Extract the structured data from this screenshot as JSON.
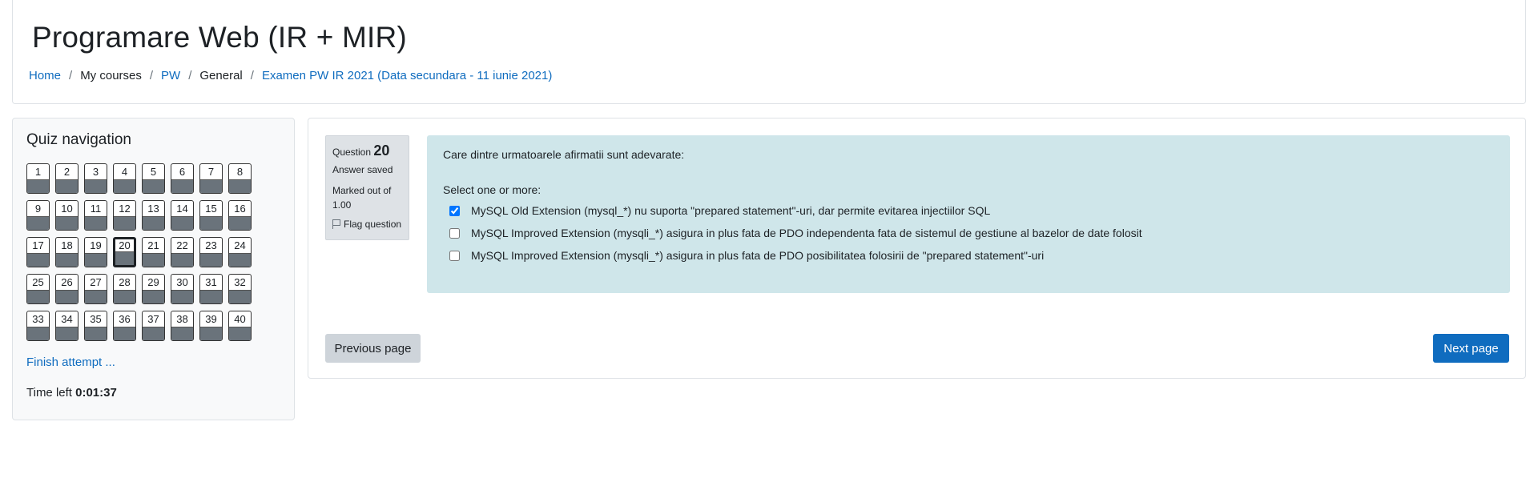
{
  "header": {
    "course_title": "Programare Web (IR + MIR)",
    "breadcrumb": [
      {
        "label": "Home",
        "link": true
      },
      {
        "label": "My courses",
        "link": false
      },
      {
        "label": "PW",
        "link": true
      },
      {
        "label": "General",
        "link": false
      },
      {
        "label": "Examen PW IR 2021 (Data secundara - 11 iunie 2021)",
        "link": true
      }
    ],
    "separator": "/"
  },
  "quiz_nav": {
    "title": "Quiz navigation",
    "questions": [
      "1",
      "2",
      "3",
      "4",
      "5",
      "6",
      "7",
      "8",
      "9",
      "10",
      "11",
      "12",
      "13",
      "14",
      "15",
      "16",
      "17",
      "18",
      "19",
      "20",
      "21",
      "22",
      "23",
      "24",
      "25",
      "26",
      "27",
      "28",
      "29",
      "30",
      "31",
      "32",
      "33",
      "34",
      "35",
      "36",
      "37",
      "38",
      "39",
      "40"
    ],
    "current": "20",
    "finish_label": "Finish attempt ...",
    "time_left_label": "Time left",
    "time_left_value": "0:01:37"
  },
  "question": {
    "label": "Question",
    "number": "20",
    "state": "Answer saved",
    "grade": "Marked out of 1.00",
    "flag_label": "Flag question",
    "text": "Care dintre urmatoarele afirmatii sunt adevarate:",
    "prompt": "Select one or more:",
    "answers": [
      {
        "label": "MySQL Old Extension (mysql_*) nu suporta \"prepared statement\"-uri, dar permite evitarea injectiilor SQL",
        "checked": true
      },
      {
        "label": "MySQL Improved Extension (mysqli_*) asigura in plus fata de PDO independenta fata de sistemul de gestiune al bazelor de date folosit",
        "checked": false
      },
      {
        "label": "MySQL Improved Extension (mysqli_*) asigura in plus fata de PDO posibilitatea folosirii de \"prepared statement\"-uri",
        "checked": false
      }
    ]
  },
  "buttons": {
    "previous": "Previous page",
    "next": "Next page"
  },
  "colors": {
    "accent": "#0f6cbf",
    "question_bg": "#cfe6ea",
    "answered_fill": "#6a737b"
  }
}
